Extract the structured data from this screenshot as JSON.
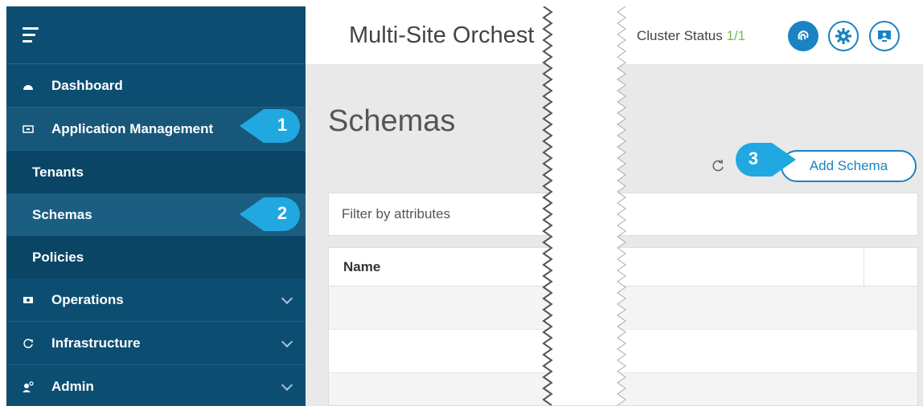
{
  "sidebar": {
    "items": [
      {
        "label": "Dashboard",
        "icon": "dashboard-icon"
      },
      {
        "label": "Application Management",
        "icon": "app-management-icon"
      },
      {
        "label": "Operations",
        "icon": "operations-icon"
      },
      {
        "label": "Infrastructure",
        "icon": "infrastructure-icon"
      },
      {
        "label": "Admin",
        "icon": "admin-icon"
      }
    ],
    "sub_items": [
      "Tenants",
      "Schemas",
      "Policies"
    ]
  },
  "header": {
    "title": "Multi-Site Orchest",
    "cluster_label": "Cluster Status",
    "cluster_value": "1/1"
  },
  "main": {
    "page_title": "Schemas",
    "add_button": "Add Schema",
    "filter_placeholder": "Filter by attributes",
    "table": {
      "columns": [
        "Name"
      ]
    }
  },
  "callouts": [
    "1",
    "2",
    "3"
  ],
  "colors": {
    "sidebar": "#0c4e72",
    "accent": "#1a83c2",
    "callout": "#21a8e0",
    "status_ok": "#6cc04a"
  }
}
